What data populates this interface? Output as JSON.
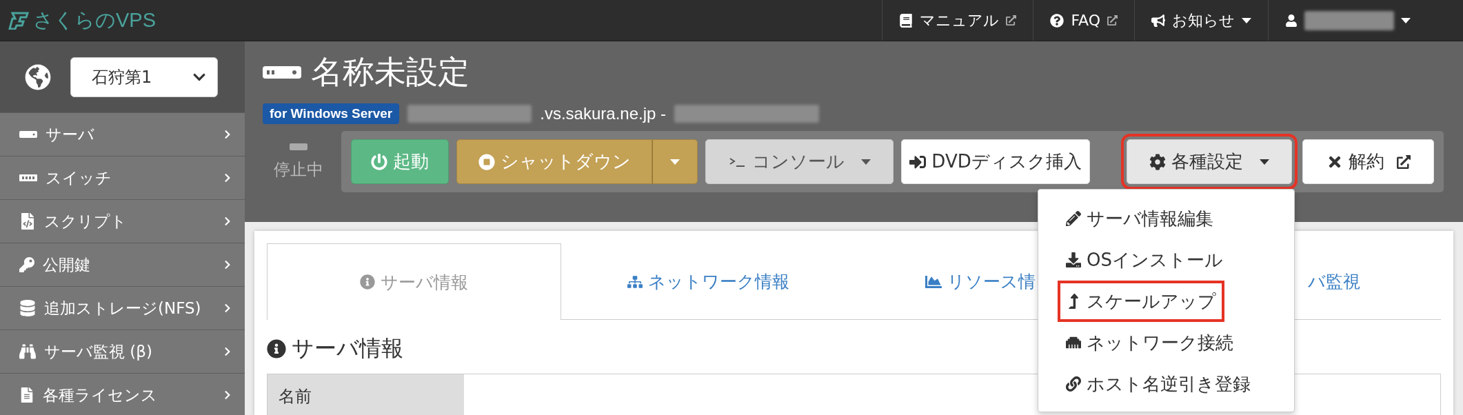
{
  "topbar": {
    "logo": "さくらのVPS",
    "links": [
      {
        "label": "マニュアル",
        "external": true,
        "menu": false
      },
      {
        "label": "FAQ",
        "external": true,
        "menu": false
      },
      {
        "label": "お知らせ",
        "external": false,
        "menu": true
      }
    ],
    "user": {
      "menu": true
    }
  },
  "sidebar": {
    "zone_select": {
      "value": "石狩第1"
    },
    "items": [
      {
        "label": "サーバ"
      },
      {
        "label": "スイッチ"
      },
      {
        "label": "スクリプト"
      },
      {
        "label": "公開鍵"
      },
      {
        "label": "追加ストレージ(NFS)"
      },
      {
        "label": "サーバ監視 (β)"
      },
      {
        "label": "各種ライセンス"
      }
    ]
  },
  "server": {
    "title": "名称未設定",
    "badge": "for Windows Server",
    "host_suffix": ".vs.sakura.ne.jp -",
    "status": "停止中"
  },
  "toolbar": {
    "buttons": [
      {
        "label": "起動",
        "kind": "start",
        "split": false,
        "menu": false,
        "external": false,
        "highlighted": false
      },
      {
        "label": "シャットダウン",
        "kind": "shutdown",
        "split": true,
        "menu": false,
        "external": false,
        "highlighted": false
      },
      {
        "label": "コンソール",
        "kind": "console",
        "split": false,
        "menu": true,
        "external": false,
        "highlighted": false
      },
      {
        "label": "DVDディスク挿入",
        "kind": "dvd",
        "split": false,
        "menu": false,
        "external": false,
        "highlighted": false
      },
      {
        "label": "各種設定",
        "kind": "settings",
        "split": false,
        "menu": true,
        "external": false,
        "highlighted": true,
        "expanded": true,
        "items": [
          {
            "label": "サーバ情報編集",
            "highlighted": false
          },
          {
            "label": "OSインストール",
            "highlighted": false
          },
          {
            "label": "スケールアップ",
            "highlighted": true
          },
          {
            "label": "ネットワーク接続",
            "highlighted": false
          },
          {
            "label": "ホスト名逆引き登録",
            "highlighted": false
          }
        ]
      },
      {
        "label": "解約",
        "kind": "cancel",
        "split": false,
        "menu": false,
        "external": true,
        "highlighted": false
      }
    ]
  },
  "tabs": [
    {
      "label": "サーバ情報",
      "selected": true
    },
    {
      "label": "ネットワーク情報",
      "selected": false
    },
    {
      "label": "リソース情",
      "selected": false
    },
    {
      "label": "バ監視",
      "selected": false
    }
  ],
  "section": {
    "heading": "サーバ情報",
    "rows": [
      {
        "label": "名前"
      }
    ]
  }
}
